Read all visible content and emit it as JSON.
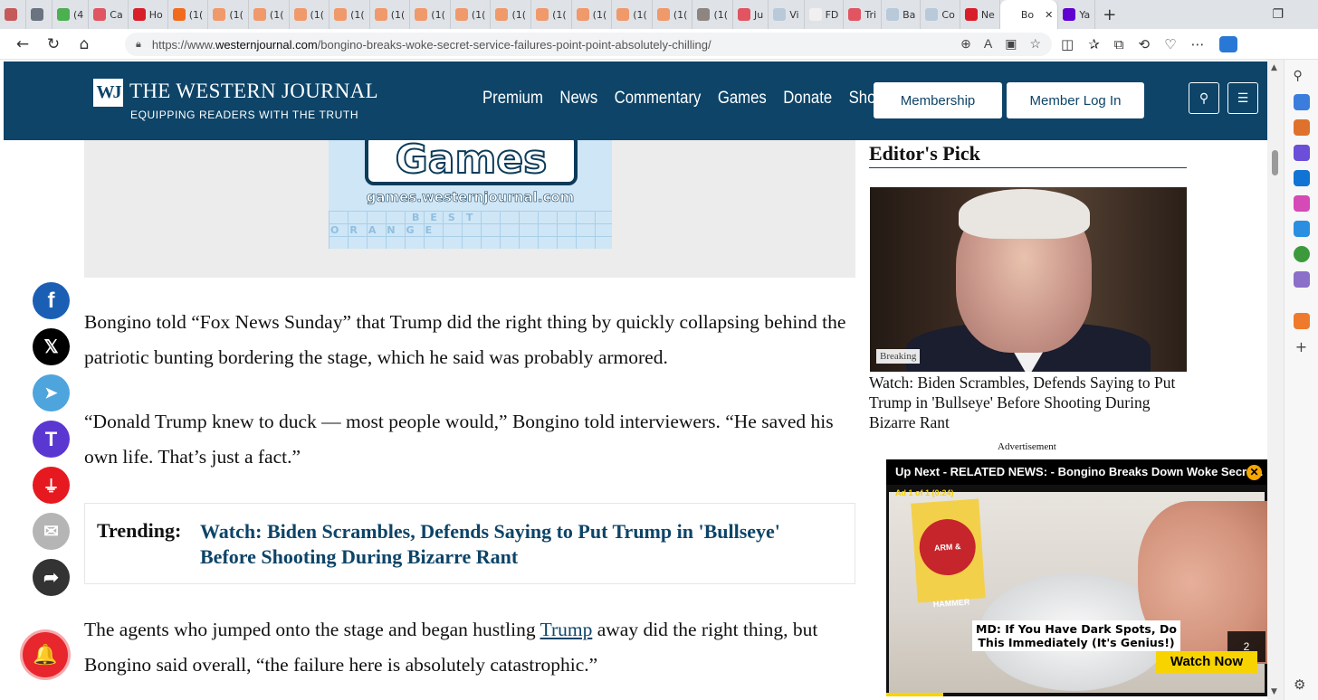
{
  "browser": {
    "tabs": [
      {
        "label": "",
        "color": "#c65a5a"
      },
      {
        "label": "",
        "color": "#6b7280"
      },
      {
        "label": "(4",
        "color": "#4caf50"
      },
      {
        "label": "Ca",
        "color": "#e05561"
      },
      {
        "label": "Ho",
        "color": "#d81e2b"
      },
      {
        "label": "(1(",
        "color": "#f26b1d"
      },
      {
        "label": "(1(",
        "color": "#f0996b"
      },
      {
        "label": "(1(",
        "color": "#f0996b"
      },
      {
        "label": "(1(",
        "color": "#f0996b"
      },
      {
        "label": "(1(",
        "color": "#f0996b"
      },
      {
        "label": "(1(",
        "color": "#f0996b"
      },
      {
        "label": "(1(",
        "color": "#f0996b"
      },
      {
        "label": "(1(",
        "color": "#f0996b"
      },
      {
        "label": "(1(",
        "color": "#f0996b"
      },
      {
        "label": "(1(",
        "color": "#f0996b"
      },
      {
        "label": "(1(",
        "color": "#f0996b"
      },
      {
        "label": "(1(",
        "color": "#f0996b"
      },
      {
        "label": "(1(",
        "color": "#f0996b"
      },
      {
        "label": "(1(",
        "color": "#8d8680"
      },
      {
        "label": "Ju",
        "color": "#e05561"
      },
      {
        "label": "Vi",
        "color": "#b8c9d9"
      },
      {
        "label": "FD",
        "color": "#f0f0f0"
      },
      {
        "label": "Tri",
        "color": "#e05561"
      },
      {
        "label": "Ba",
        "color": "#b8c9d9"
      },
      {
        "label": "Co",
        "color": "#b8c9d9"
      },
      {
        "label": "Ne",
        "color": "#d81e2b"
      },
      {
        "label": "Bo",
        "color": "#ffffff",
        "active": true
      },
      {
        "label": "Ya",
        "color": "#6001d2"
      }
    ],
    "close_tab": "✕",
    "new_tab": "+",
    "window_restore": "❐",
    "url_prefix": "https://www.",
    "url_host": "westernjournal.com",
    "url_path": "/bongino-breaks-woke-secret-service-failures-point-point-absolutely-chilling/",
    "icons": [
      "back-icon",
      "reload-icon",
      "home-icon",
      "lock-icon",
      "zoom-icon",
      "read-aloud-icon",
      "immersive-reader-icon",
      "favorite-icon",
      "split-screen-icon",
      "favorites-list-icon",
      "collections-icon",
      "history-icon",
      "browser-essentials-icon",
      "more-icon",
      "copilot-icon"
    ]
  },
  "site": {
    "logo_mark": "WJ",
    "logo_title": "THE WESTERN JOURNAL",
    "logo_tagline": "EQUIPPING READERS WITH THE TRUTH",
    "nav": [
      "Premium",
      "News",
      "Commentary",
      "Games",
      "Donate",
      "Shop"
    ],
    "membership_label": "Membership",
    "login_label": "Member Log In",
    "colors": {
      "header": "#0d4468",
      "link": "#0d4468"
    }
  },
  "games_ad": {
    "word": "Games",
    "url": "games.westernjournal.com",
    "grid_words": [
      "BEST",
      "ORANGE"
    ]
  },
  "article": {
    "p1": "Bongino told “Fox News Sunday” that Trump did the right thing by quickly collapsing behind the patriotic bunting bordering the stage, which he said was probably armored.",
    "p2": "“Donald Trump knew to duck — most people would,” Bongino told interviewers. “He saved his own life. That’s just a fact.”",
    "p3_before": "The agents who jumped onto the stage and began hustling ",
    "p3_link": "Trump",
    "p3_after": " away did the right thing, but Bongino said overall, “the failure here is absolutely catastrophic.”",
    "trending_label": "Trending:",
    "trending_link": "Watch: Biden Scrambles, Defends Saying to Put Trump in 'Bullseye' Before Shooting During Bizarre Rant"
  },
  "share": [
    {
      "name": "facebook",
      "glyph": "f",
      "color": "#1b5fb5"
    },
    {
      "name": "x",
      "glyph": "𝕏",
      "color": "#000000"
    },
    {
      "name": "telegram",
      "glyph": "➤",
      "color": "#4ea4dc"
    },
    {
      "name": "truth-social",
      "glyph": "T",
      "color": "#5a37d1"
    },
    {
      "name": "gettr",
      "glyph": "⏚",
      "color": "#e5191f"
    },
    {
      "name": "email",
      "glyph": "✉",
      "color": "#b5b5b5"
    },
    {
      "name": "share",
      "glyph": "➦",
      "color": "#333333"
    }
  ],
  "notification_bell": "🔔",
  "sidebar": {
    "editors_pick": "Editor's Pick",
    "badge": "Breaking",
    "headline": "Watch: Biden Scrambles, Defends Saying to Put Trump in 'Bullseye' Before Shooting During Bizarre Rant",
    "advertisement": "Advertisement"
  },
  "video": {
    "title": "Up Next - RELATED NEWS: - Bongino Breaks Down Woke Secre...",
    "close": "✕",
    "ad_counter": "Ad 1 of 1 (0:24)",
    "product": "ARM & HAMMER",
    "caption": "MD: If You Have Dark Spots, Do This Immediately (It's Genius!)",
    "watch_now": "Watch Now",
    "skip_count": "2",
    "progress": 0.15
  }
}
